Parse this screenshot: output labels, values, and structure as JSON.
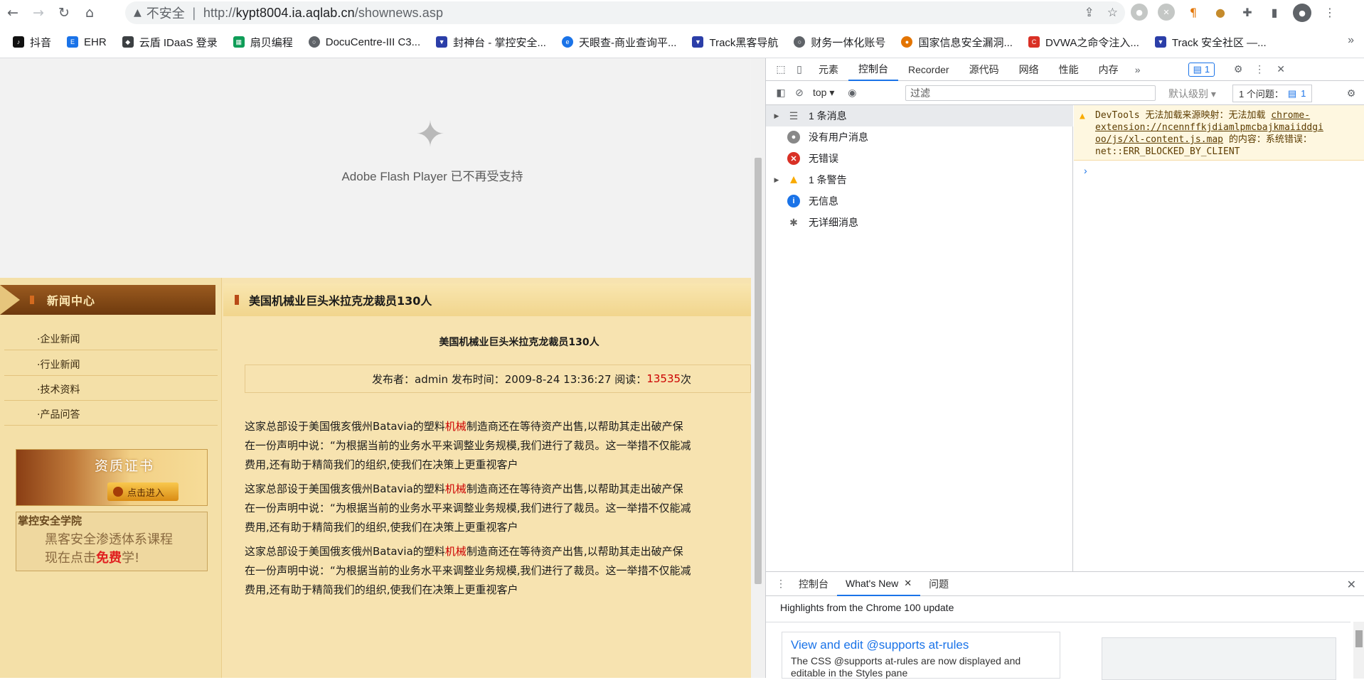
{
  "browser": {
    "insecure_label": "不安全",
    "url_prefix": "http://",
    "url_host": "kypt8004.ia.aqlab.cn",
    "url_path": "/shownews.asp"
  },
  "bookmarks": [
    {
      "label": "抖音",
      "color": "#111111"
    },
    {
      "label": "EHR",
      "color": "#1a73e8"
    },
    {
      "label": "云盾 IDaaS 登录",
      "color": "#3c4043"
    },
    {
      "label": "扇贝编程",
      "color": "#0f9d58"
    },
    {
      "label": "DocuCentre-III C3...",
      "color": "#5f6368"
    },
    {
      "label": "封神台 - 掌控安全...",
      "color": "#2b3ea8"
    },
    {
      "label": "天眼查-商业查询平...",
      "color": "#1a73e8"
    },
    {
      "label": "Track黑客导航",
      "color": "#2b3ea8"
    },
    {
      "label": "财务一体化账号",
      "color": "#5f6368"
    },
    {
      "label": "国家信息安全漏洞...",
      "color": "#e37400"
    },
    {
      "label": "DVWA之命令注入...",
      "color": "#d93025"
    },
    {
      "label": "Track 安全社区 —...",
      "color": "#2b3ea8"
    }
  ],
  "flash": {
    "message": "Adobe Flash Player 已不再受支持"
  },
  "sidebar": {
    "title": "新闻中心",
    "links": [
      "·企业新闻",
      "·行业新闻",
      "·技术资料",
      "·产品问答"
    ],
    "cert_title": "资质证书",
    "cert_button": "点击进入",
    "academy_title": "掌控安全学院",
    "academy_line1": "黑客安全渗透体系课程",
    "academy_line2_pre": "现在点击",
    "academy_line2_free": "免费",
    "academy_line2_post": "学!"
  },
  "article": {
    "header": "美国机械业巨头米拉克龙裁员130人",
    "title": "美国机械业巨头米拉克龙裁员130人",
    "meta_prefix": "发布者：admin 发布时间：2009-8-24 13:36:27 阅读：",
    "views": "13535",
    "meta_suffix": "次",
    "para_line1_a": "这家总部设于美国俄亥俄州Batavia的塑料",
    "para_line1_hl": "机械",
    "para_line1_b": "制造商还在等待资产出售,以帮助其走出破产保",
    "para_line2": "在一份声明中说：“为根据当前的业务水平来调整业务规模,我们进行了裁员。这一举措不仅能减",
    "para_line3": "费用,还有助于精简我们的组织,使我们在决策上更重视客户"
  },
  "devtools": {
    "tabs": [
      "元素",
      "控制台",
      "Recorder",
      "源代码",
      "网络",
      "性能",
      "内存"
    ],
    "active_tab": "控制台",
    "issues_badge": "1",
    "context": "top",
    "filter_placeholder": "过滤",
    "level": "默认级别",
    "issues_label": "1 个问题：",
    "issues_count": "1",
    "sidebar": [
      {
        "label": "1 条消息",
        "icon": "list-icon"
      },
      {
        "label": "没有用户消息",
        "icon": "user-icon"
      },
      {
        "label": "无错误",
        "icon": "error-icon"
      },
      {
        "label": "1 条警告",
        "icon": "warning-icon"
      },
      {
        "label": "无信息",
        "icon": "info-icon"
      },
      {
        "label": "无详细消息",
        "icon": "bug-icon"
      }
    ],
    "warning_pre": "DevTools 无法加载来源映射：无法加载 ",
    "warning_link_1": "chrome-",
    "warning_link_2": "extension://ncennffkjdiamlpmcbajkmaiiddgi",
    "warning_link_3": "oo/js/xl-content.js.map",
    "warning_post_1": " 的内容：系统错误：",
    "warning_post_2": "net::ERR_BLOCKED_BY_CLIENT",
    "drawer_tabs": [
      "控制台",
      "What's New",
      "问题"
    ],
    "drawer_active": "What's New",
    "highlights": "Highlights from the Chrome 100 update",
    "card_title": "View and edit @supports at-rules",
    "card_desc": "The CSS @supports at-rules are now displayed and editable in the Styles pane"
  }
}
